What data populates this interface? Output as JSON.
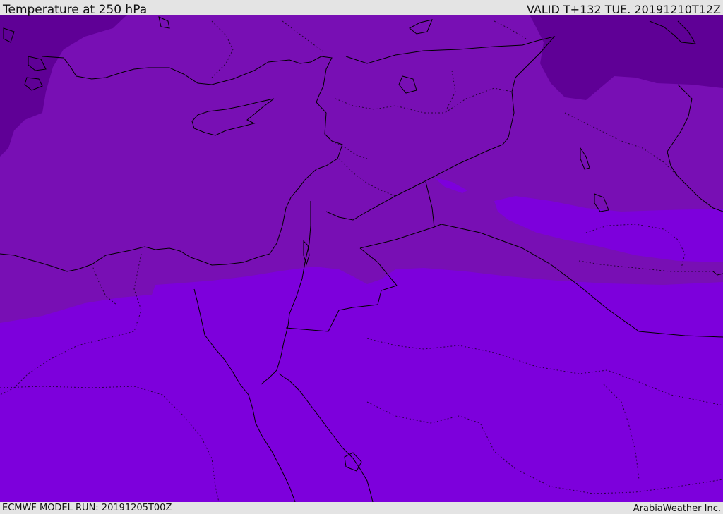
{
  "header": {
    "title": "Temperature at 250 hPa",
    "valid_time": "VALID T+132 TUE. 20191210T12Z"
  },
  "footer": {
    "model_run": "ECMWF MODEL RUN: 20191205T00Z",
    "credit": "ArabiaWeather Inc."
  },
  "map": {
    "field_colors": {
      "coldest": "#5f0096",
      "cold": "#780fb4",
      "cool": "#7d00dc"
    },
    "boundary_color": "#000000"
  }
}
